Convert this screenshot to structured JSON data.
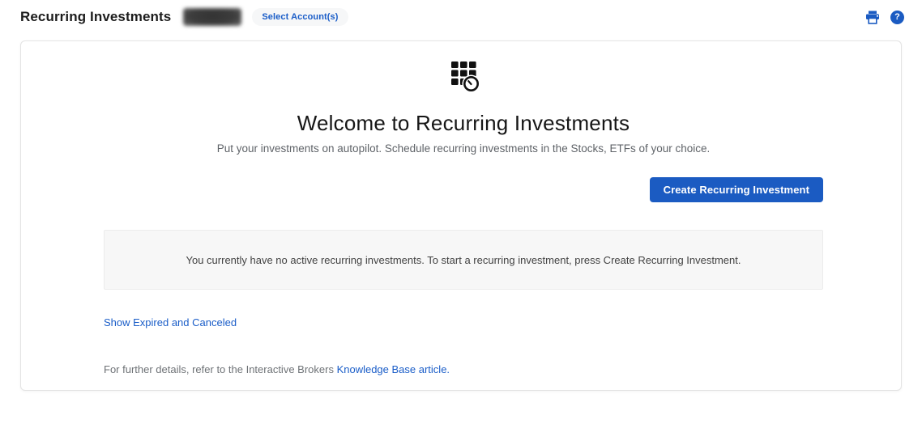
{
  "header": {
    "title": "Recurring Investments",
    "select_accounts_label": "Select Account(s)",
    "help_glyph": "?",
    "icons": {
      "print": "printer-icon",
      "help": "help-icon"
    }
  },
  "main": {
    "hero_icon": "recurring-grid-clock-icon",
    "welcome_title": "Welcome to Recurring Investments",
    "subtitle": "Put your investments on autopilot. Schedule recurring investments in the Stocks, ETFs of your choice.",
    "create_button_label": "Create Recurring Investment",
    "empty_state_message": "You currently have no active recurring investments. To start a recurring investment, press Create Recurring Investment.",
    "show_expired_link": "Show Expired and Canceled",
    "footer_text_prefix": "For further details, refer to the Interactive Brokers ",
    "footer_link_label": "Knowledge Base article."
  },
  "colors": {
    "accent_blue": "#1b5bc2",
    "link_blue": "#1a5dc8",
    "text_dark": "#1c1c1c",
    "text_gray": "#5f6368",
    "info_box_bg": "#f7f7f7"
  }
}
